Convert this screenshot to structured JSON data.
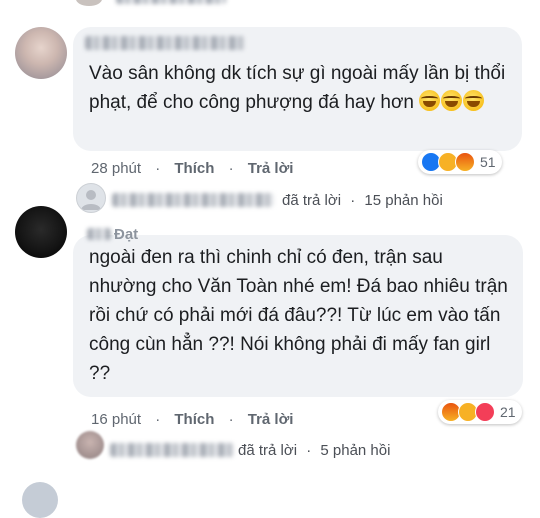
{
  "comment1": {
    "text": "Vào sân không dk tích sự gì ngoài mấy lần bị thổi phạt, để cho công phượng đá hay hơn",
    "emoji": [
      "laughing-tears-emoji",
      "laughing-tears-emoji",
      "laughing-tears-emoji"
    ],
    "time": "28 phút",
    "like_label": "Thích",
    "reply_label": "Trả lời",
    "reactions": [
      "like",
      "haha",
      "angry"
    ],
    "reaction_count": "51",
    "replied_label": "đã trả lời",
    "reply_count_label": "15 phản hồi"
  },
  "comment2": {
    "author_visible": "Đạt",
    "text": "ngoài đen ra thì chinh chỉ có đen, trận sau nhường cho Văn Toàn nhé em! Đá bao nhiêu trận rồi chứ có phải mới đá đâu??! Từ lúc em vào tấn công cùn hẳn ??! Nói không phải đi mấy fan girl ??",
    "time": "16 phút",
    "like_label": "Thích",
    "reply_label": "Trả lời",
    "reactions": [
      "angry",
      "haha",
      "love"
    ],
    "reaction_count": "21",
    "replied_label": "đã trả lời",
    "reply_count_label": "5 phản hồi"
  },
  "separator": "·",
  "colors": {
    "bubble": "#f0f2f5",
    "like": "#1877f2",
    "love": "#f33e58",
    "angry": "#e9710f",
    "haha": "#f7b125"
  }
}
